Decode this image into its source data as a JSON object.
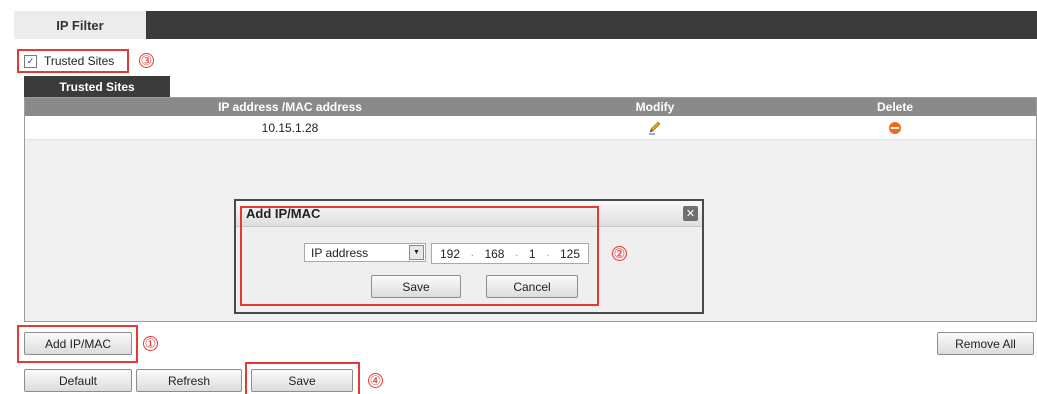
{
  "header": {
    "tab_title": "IP Filter"
  },
  "trusted_sites": {
    "checkbox_label": "Trusted Sites",
    "checked": true,
    "tab_label": "Trusted Sites",
    "columns": [
      "IP address /MAC address",
      "Modify",
      "Delete"
    ],
    "rows": [
      {
        "address": "10.15.1.28",
        "modify_icon": "pencil-icon",
        "delete_icon": "minus-circle-icon"
      }
    ]
  },
  "dialog": {
    "title": "Add IP/MAC",
    "close_glyph": "✕",
    "type_selected": "IP address",
    "ip_octets": [
      "192",
      "168",
      "1",
      "125"
    ],
    "save_label": "Save",
    "cancel_label": "Cancel"
  },
  "actions": {
    "add_label": "Add IP/MAC",
    "remove_all_label": "Remove All",
    "default_label": "Default",
    "refresh_label": "Refresh",
    "save_label": "Save"
  },
  "callouts": [
    "①",
    "②",
    "③",
    "④"
  ],
  "colors": {
    "callout_red": "#e53935",
    "header_dark": "#3b3b3b",
    "table_header": "#8a8a8a",
    "delete_orange": "#f26b1d",
    "edit_yellow": "#e3a21a"
  }
}
